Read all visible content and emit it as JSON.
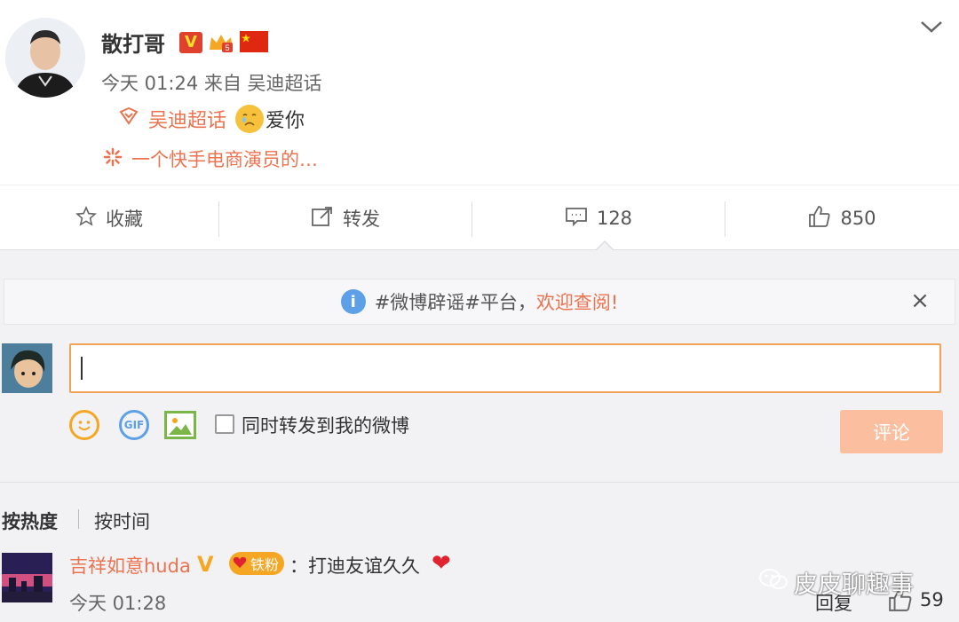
{
  "post": {
    "username": "散打哥",
    "verified_badge": "V",
    "time_source": "今天 01:24 来自 吴迪超话",
    "topic_tag": "吴迪超话",
    "love_text": "爱你",
    "tail_text": "一个快手电商演员的…",
    "icons": [
      "avatar",
      "verified-icon",
      "crown-badge-icon",
      "china-flag-icon",
      "chevron-down-icon",
      "supertopic-icon",
      "cry-emoji-icon",
      "spark-icon"
    ]
  },
  "actions": {
    "favorite": "收藏",
    "repost": "转发",
    "comment_count": "128",
    "like_count": "850"
  },
  "notice": {
    "prefix": "#微博辟谣#平台，",
    "highlight": "欢迎查阅!",
    "close": "×"
  },
  "composer": {
    "input_value": "",
    "checkbox_label": "同时转发到我的微博",
    "submit_label": "评论",
    "tools": [
      "smile-icon",
      "gif-icon",
      "image-icon"
    ]
  },
  "sort": {
    "hot": "按热度",
    "time": "按时间"
  },
  "comments": [
    {
      "name": "吉祥如意huda",
      "verified": "V",
      "fan_badge": "铁粉",
      "text": "：打迪友谊久久",
      "time": "今天 01:28",
      "reply": "回复",
      "likes": "59"
    }
  ],
  "watermark": "皮皮聊趣事",
  "colors": {
    "accent": "#eb7350",
    "input_border": "#f0a257",
    "button_disabled": "#fbbf9f",
    "background_gray": "#f2f2f5"
  }
}
